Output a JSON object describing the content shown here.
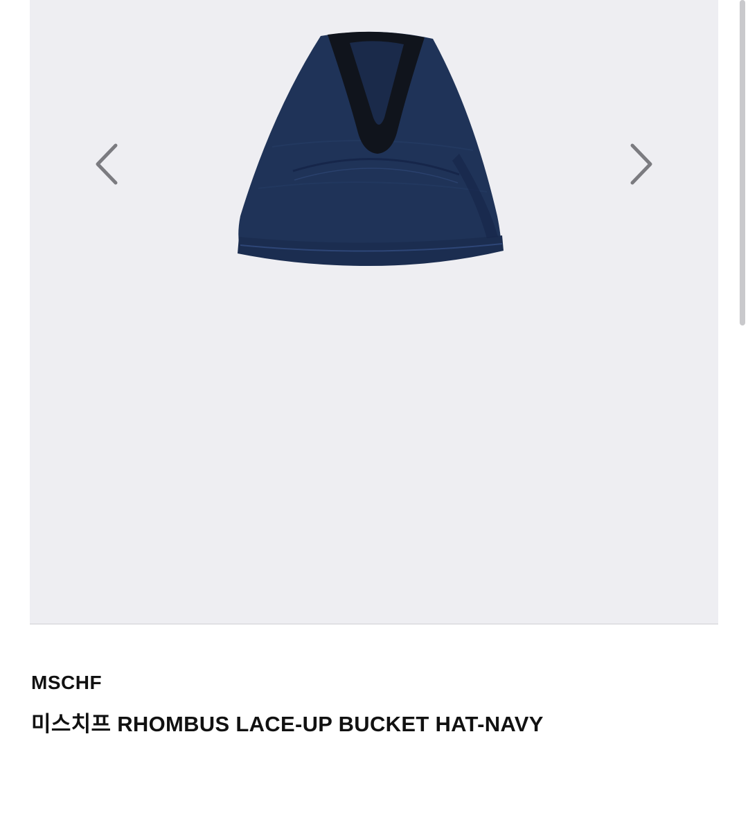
{
  "product": {
    "brand": "MSCHF",
    "title": "미스치프 RHOMBUS LACE-UP BUCKET HAT-NAVY"
  },
  "gallery": {
    "image_subject": "navy bucket hat",
    "prev_icon": "chevron-left-icon",
    "next_icon": "chevron-right-icon",
    "background_color": "#eeeef2"
  },
  "colors": {
    "hat_navy": "#1f3358",
    "lace_black": "#10141c",
    "arrow_gray": "#7b7b80",
    "text": "#111111"
  }
}
